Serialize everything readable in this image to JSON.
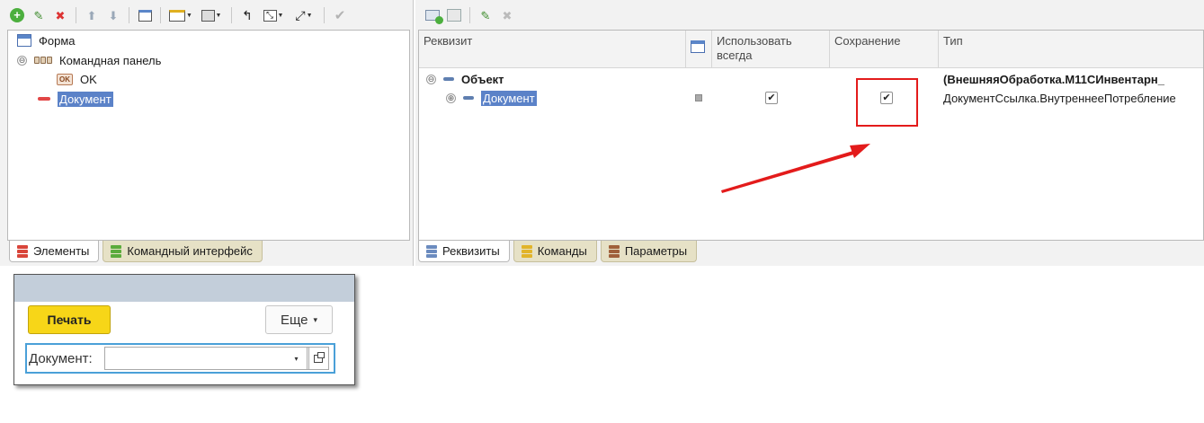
{
  "left_tree": {
    "items": [
      {
        "label": "Форма",
        "icon": "form-icon"
      },
      {
        "label": "Командная панель",
        "icon": "command-panel-icon",
        "expander": "⊖"
      },
      {
        "label": "OK",
        "icon": "ok-button-icon",
        "icon_text": "OK"
      },
      {
        "label": "Документ",
        "icon": "field-red-icon",
        "selected": true
      }
    ],
    "tabs": [
      {
        "label": "Элементы",
        "active": true,
        "color": "#d9453a"
      },
      {
        "label": "Командный интерфейс",
        "active": false,
        "color": "#5bab3c"
      }
    ]
  },
  "right_grid": {
    "headers": {
      "requisite": "Реквизит",
      "always_use": "Использовать всегда",
      "save": "Сохранение",
      "type": "Тип"
    },
    "rows": [
      {
        "name": "Объект",
        "expander": "⊖",
        "type": "(ВнешняяОбработка.М11СИнвентарн_",
        "bold": true
      },
      {
        "name": "Документ",
        "expander": "⊕",
        "type": "ДокументСсылка.ВнутреннееПотребление",
        "always_use": "✔",
        "save": "✔",
        "selected": true
      }
    ],
    "tabs": [
      {
        "label": "Реквизиты",
        "active": true,
        "color": "#6b8bbf"
      },
      {
        "label": "Команды",
        "active": false,
        "color": "#e1b42a"
      },
      {
        "label": "Параметры",
        "active": false,
        "color": "#a0603a"
      }
    ]
  },
  "preview": {
    "print_label": "Печать",
    "more_label": "Еще",
    "more_arrow": "▾",
    "field_label": "Документ:",
    "field_value": "",
    "field_dropdown": "▾"
  },
  "icons": {
    "add": "⊕",
    "edit": "✎",
    "delete": "✖",
    "up": "⬆",
    "down": "⬇",
    "check": "✔"
  },
  "colors": {
    "selection": "#5b82c8",
    "highlight_box": "#e31b1b",
    "print_button": "#f7d618",
    "field_focus": "#4aa0d8"
  }
}
